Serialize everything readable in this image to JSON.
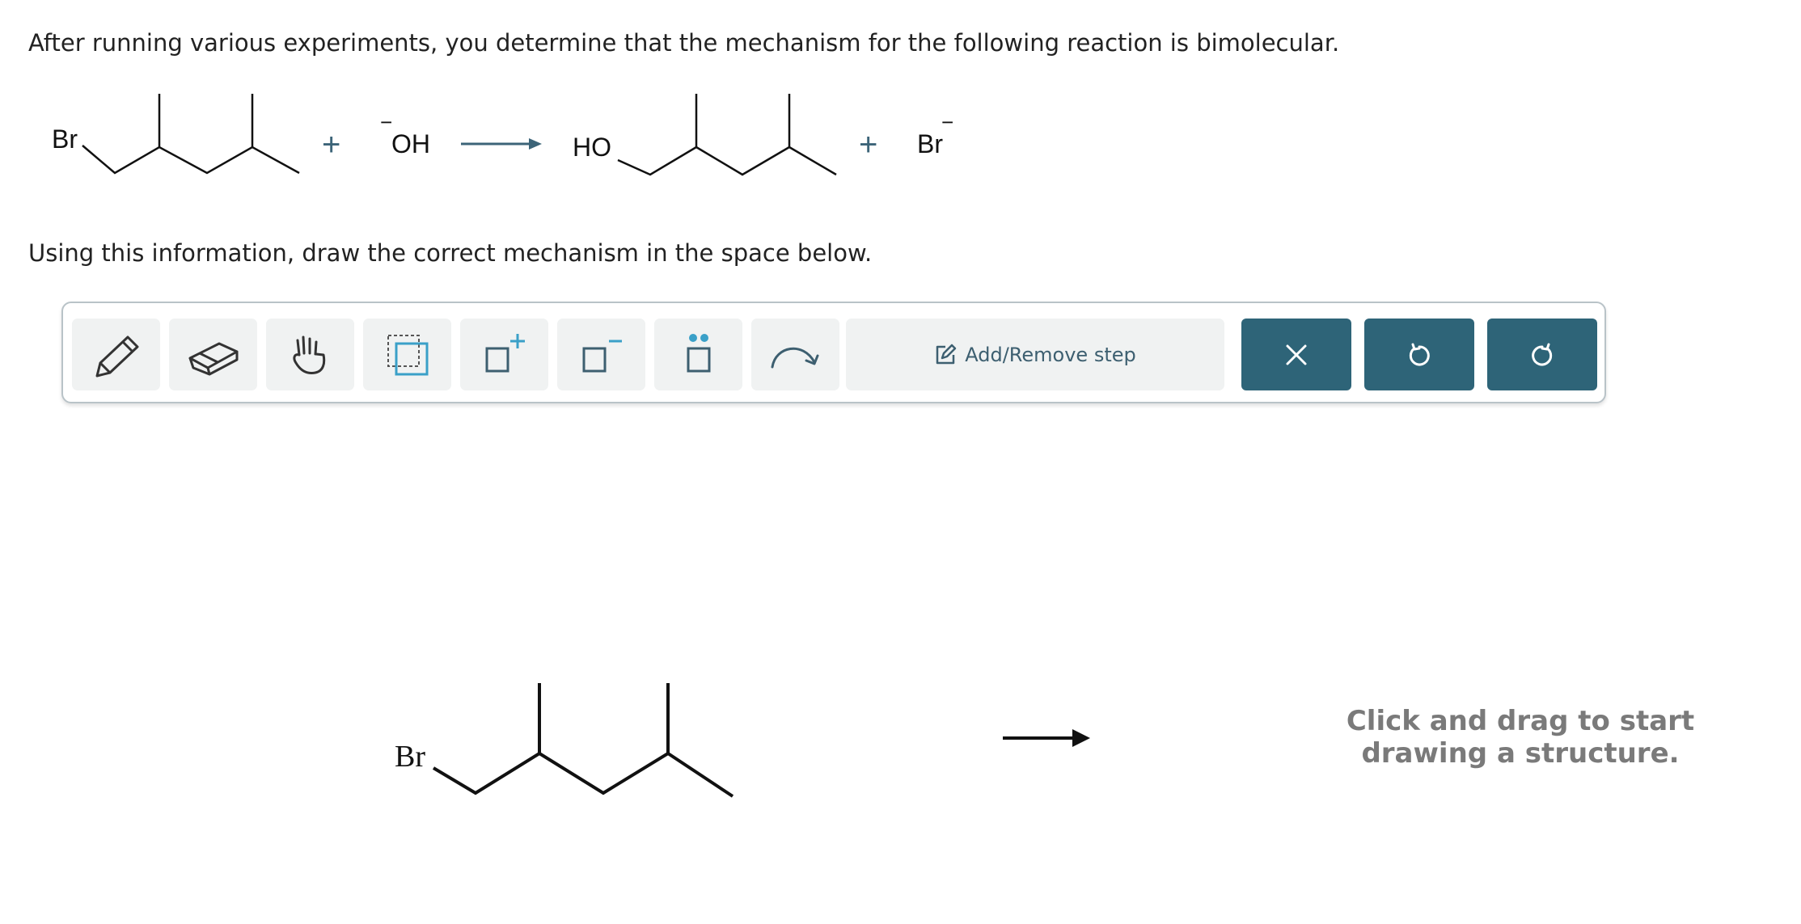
{
  "question": {
    "intro": "After running various experiments, you determine that the mechanism for the following reaction is bimolecular.",
    "instruction": "Using this information, draw the correct mechanism in the space below."
  },
  "reaction": {
    "reactant1_label": "Br",
    "plus1": "+",
    "reagent_label": "OH",
    "reagent_charge": "−",
    "product1_label": "HO",
    "plus2": "+",
    "product2_label": "Br",
    "product2_charge": "−"
  },
  "toolbar": {
    "tools": [
      "pencil-icon",
      "eraser-icon",
      "hand-icon",
      "selection-icon",
      "add-charge-icon",
      "remove-charge-icon",
      "lone-pair-icon",
      "curved-arrow-icon"
    ],
    "step_label": "Add/Remove step",
    "actions": [
      "close-icon",
      "undo-icon",
      "redo-icon"
    ],
    "accent_color": "#2e6478",
    "tool_bg": "#f0f2f2"
  },
  "canvas": {
    "molecule_label": "Br",
    "hint": "Click and drag to start drawing a structure."
  }
}
